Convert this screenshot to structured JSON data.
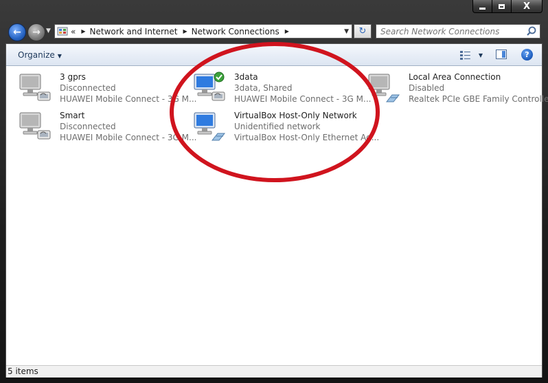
{
  "window": {
    "close_label": "X"
  },
  "address": {
    "prefix": "«",
    "crumbs": [
      "Network and Internet",
      "Network Connections"
    ]
  },
  "search": {
    "placeholder": "Search Network Connections"
  },
  "toolbar": {
    "organize_label": "Organize"
  },
  "connections": [
    {
      "name": "3 gprs",
      "status": "Disconnected",
      "device": "HUAWEI Mobile Connect - 3G M...",
      "icon": "modem-computer-icon"
    },
    {
      "name": "3data",
      "status": "3data, Shared",
      "device": "HUAWEI Mobile Connect - 3G M...",
      "icon": "modem-computer-connected-icon"
    },
    {
      "name": "Local Area Connection",
      "status": "Disabled",
      "device": "Realtek PCIe GBE Family Controller",
      "icon": "ethernet-computer-icon"
    },
    {
      "name": "Smart",
      "status": "Disconnected",
      "device": "HUAWEI Mobile Connect - 3G M...",
      "icon": "modem-computer-icon"
    },
    {
      "name": "VirtualBox Host-Only Network",
      "status": "Unidentified network",
      "device": "VirtualBox Host-Only Ethernet Ad...",
      "icon": "ethernet-computer-icon"
    }
  ],
  "statusbar": {
    "count": "5 items"
  },
  "colors": {
    "annotation": "#d0141e",
    "link": "#1e395b"
  }
}
